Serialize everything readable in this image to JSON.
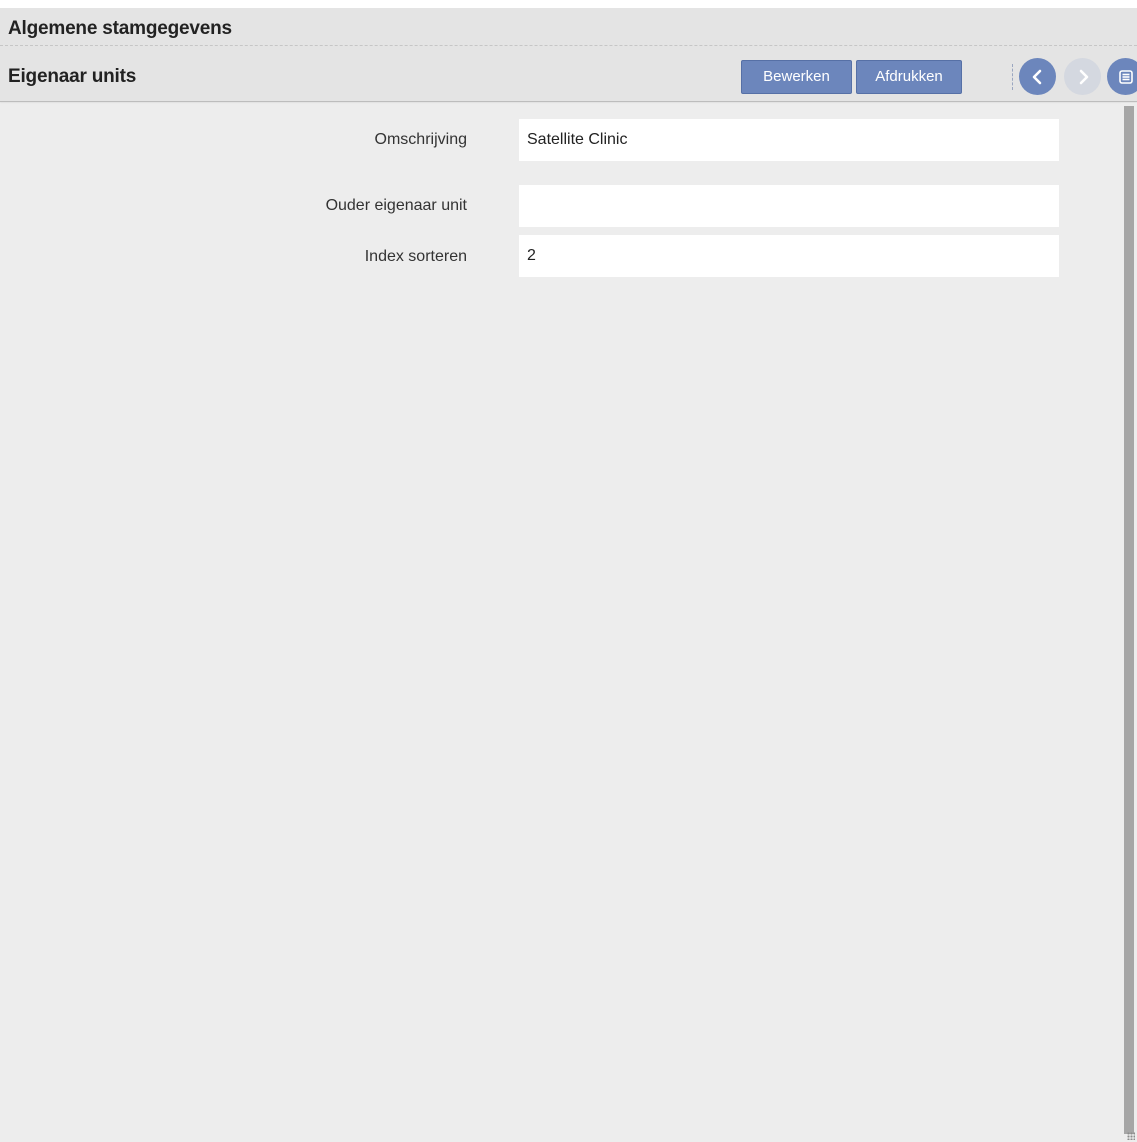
{
  "header": {
    "title": "Algemene stamgegevens",
    "subtitle": "Eigenaar units"
  },
  "toolbar": {
    "edit_label": "Bewerken",
    "print_label": "Afdrukken"
  },
  "form": {
    "fields": [
      {
        "label": "Omschrijving",
        "value": "Satellite Clinic"
      },
      {
        "label": "Ouder eigenaar unit",
        "value": ""
      },
      {
        "label": "Index sorteren",
        "value": "2"
      }
    ]
  },
  "icons": {
    "prev": "chevron-left-icon",
    "next": "chevron-right-icon",
    "menu": "menu-icon"
  },
  "colors": {
    "accent": "#6c86bc",
    "disabled": "#d4d8e0",
    "background": "#ededed",
    "header": "#e4e4e4"
  }
}
